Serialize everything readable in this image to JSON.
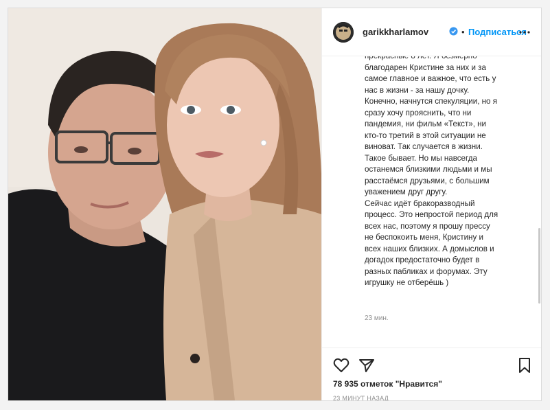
{
  "post": {
    "username": "garikkharlamov",
    "follow_label": "Подписаться",
    "separator": "•",
    "caption": "прекрасные 8 лет. Я безмерно\nблагодарен Кристине за них и за\nсамое главное и важное, что есть у\nнас в жизни - за нашу дочку.\nКонечно, начнутся спекуляции, но я\nсразу хочу прояснить, что ни\nпандемия, ни фильм «Текст», ни\nкто-то третий в этой ситуации не\nвиноват. Так случается в жизни.\nТакое бывает. Но мы навсегда\nостанемся близкими людьми и мы\nрасстаёмся друзьями, с большим\nуважением друг другу.\nСейчас идёт бракоразводный\nпроцесс. Это непростой период для\nвсех нас, поэтому я прошу прессу\nне беспокоить меня, Кристину и\nвсех наших близких. А домыслов и\nдогадок предостаточно будет в\nразных пабликах и форумах. Эту\nигрушку не отберёшь )",
    "caption_time": "23 мин.",
    "likes": "78 935 отметок \"Нравится\"",
    "posted_ago": "23 МИНУТ НАЗАД"
  },
  "icons": {
    "verified": "verified-badge-icon",
    "more": "more-options-icon",
    "like": "heart-icon",
    "share": "paper-plane-icon",
    "save": "bookmark-icon"
  },
  "colors": {
    "accent": "#0095f6",
    "text": "#262626",
    "muted": "#8e8e8e",
    "border": "#dbdbdb"
  }
}
